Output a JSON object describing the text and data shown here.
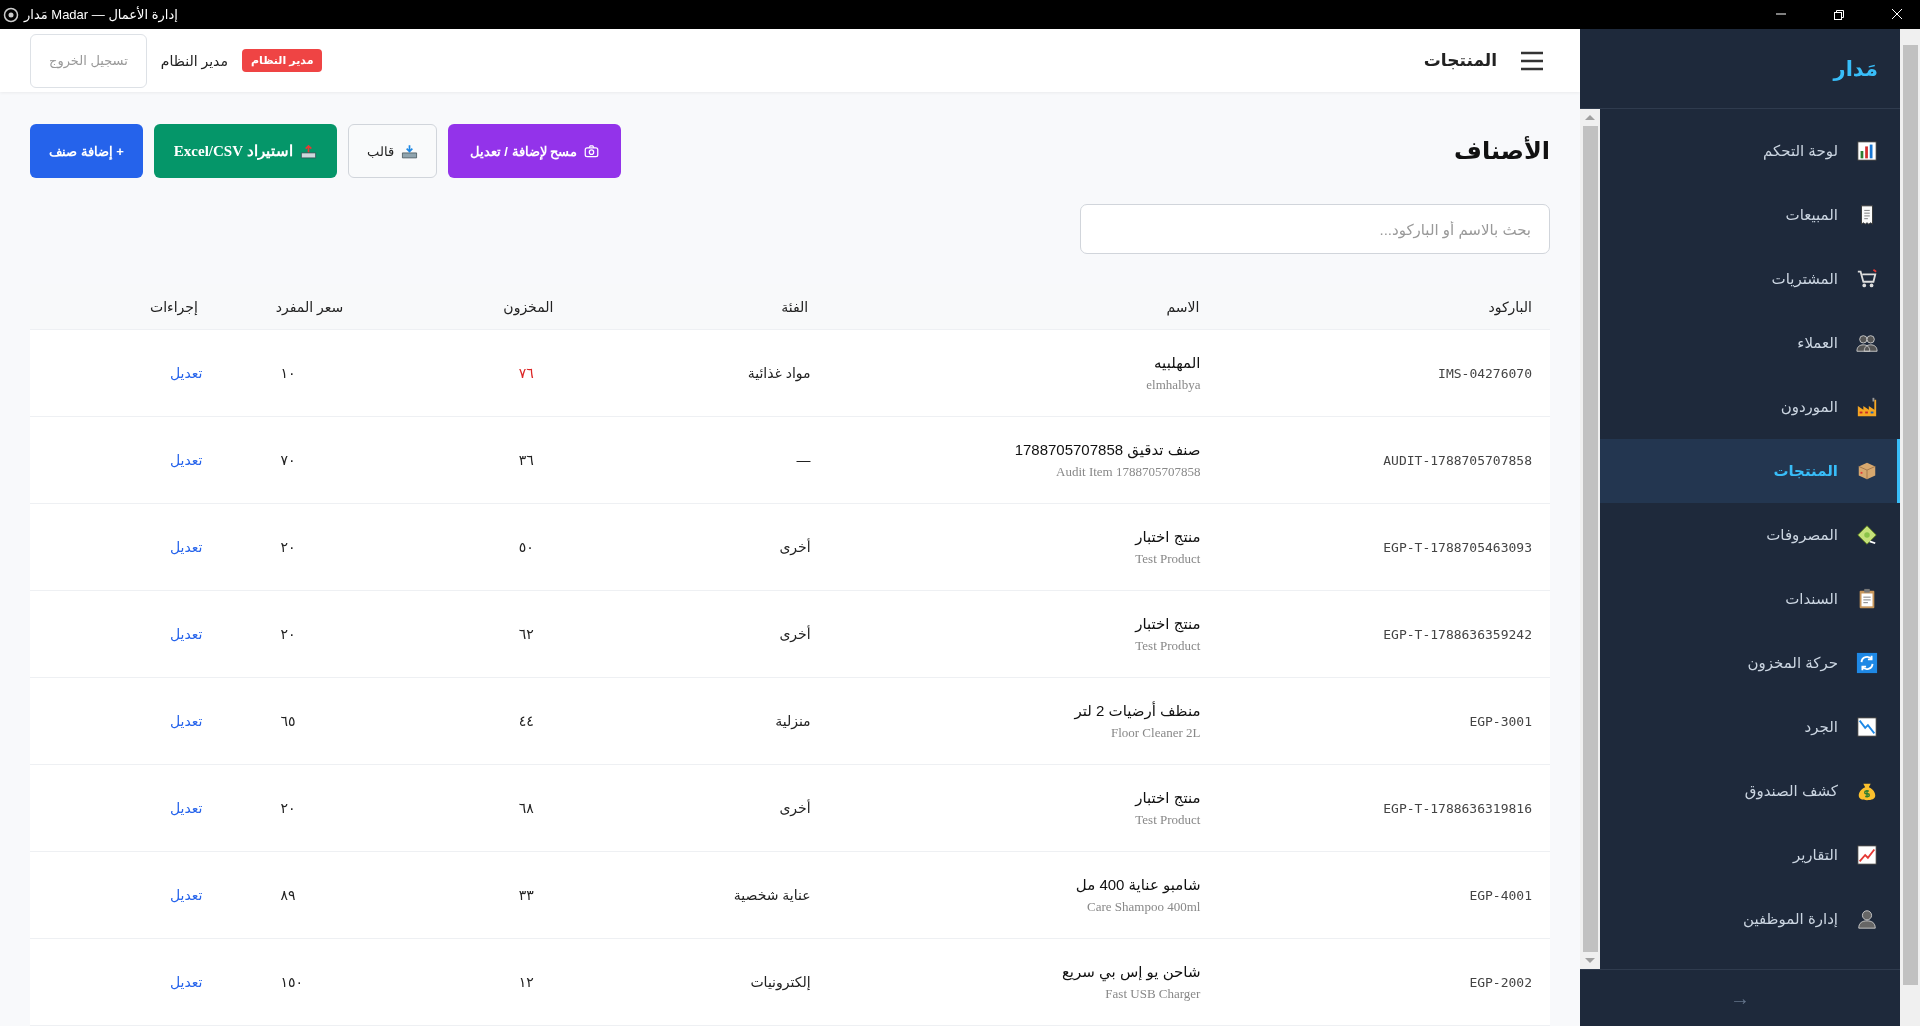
{
  "window": {
    "title": "مَدار Madar — إدارة الأعمال"
  },
  "header": {
    "title": "المنتجات",
    "role_badge": "مدير النظام",
    "user": "مدير النظام",
    "logout": "تسجيل الخروج"
  },
  "page": {
    "title": "الأصناف",
    "buttons": [
      {
        "kind": "scan",
        "label": "مسح لإضافة / تعديل"
      },
      {
        "kind": "template",
        "label": "قالب"
      },
      {
        "kind": "import",
        "label": "استيراد Excel/CSV"
      },
      {
        "kind": "add",
        "label": "+ إضافة صنف"
      }
    ],
    "search": {
      "placeholder": "بحث بالاسم أو الباركود..."
    }
  },
  "table": {
    "columns": [
      "الباركود",
      "الاسم",
      "الفئة",
      "المخزون",
      "سعر المفرد",
      "إجراءات"
    ],
    "rows": [
      {
        "barcode": "IMS-04276070",
        "name": "المهلبيه",
        "name_latin": "elmhalbya",
        "category": "مواد غذائية",
        "stock": "٧٦",
        "stock_low": true,
        "price": "١٠",
        "action": "تعديل"
      },
      {
        "barcode": "AUDIT-1788705707858",
        "name": "صنف تدقيق 1788705707858",
        "name_latin": "Audit Item 1788705707858",
        "category": "—",
        "stock": "٣٦",
        "stock_low": false,
        "price": "٧٠",
        "action": "تعديل"
      },
      {
        "barcode": "EGP-T-1788705463093",
        "name": "منتج اختبار",
        "name_latin": "Test Product",
        "category": "أخرى",
        "stock": "٥٠",
        "stock_low": false,
        "price": "٢٠",
        "action": "تعديل"
      },
      {
        "barcode": "EGP-T-1788636359242",
        "name": "منتج اختبار",
        "name_latin": "Test Product",
        "category": "أخرى",
        "stock": "٦٢",
        "stock_low": false,
        "price": "٢٠",
        "action": "تعديل"
      },
      {
        "barcode": "EGP-3001",
        "name": "منظف أرضيات 2 لتر",
        "name_latin": "Floor Cleaner 2L",
        "category": "منزلية",
        "stock": "٤٤",
        "stock_low": false,
        "price": "٦٥",
        "action": "تعديل"
      },
      {
        "barcode": "EGP-T-1788636319816",
        "name": "منتج اختبار",
        "name_latin": "Test Product",
        "category": "أخرى",
        "stock": "٦٨",
        "stock_low": false,
        "price": "٢٠",
        "action": "تعديل"
      },
      {
        "barcode": "EGP-4001",
        "name": "شامبو عناية 400 مل",
        "name_latin": "Care Shampoo 400ml",
        "category": "عناية شخصية",
        "stock": "٣٣",
        "stock_low": false,
        "price": "٨٩",
        "action": "تعديل"
      },
      {
        "barcode": "EGP-2002",
        "name": "شاحن يو إس بي سريع",
        "name_latin": "Fast USB Charger",
        "category": "إلكترونيات",
        "stock": "١٢",
        "stock_low": false,
        "price": "١٥٠",
        "action": "تعديل"
      }
    ]
  },
  "sidebar": {
    "logo": "مَدار",
    "items": [
      {
        "label": "لوحة التحكم",
        "selected": false
      },
      {
        "label": "المبيعات",
        "selected": false
      },
      {
        "label": "المشتريات",
        "selected": false
      },
      {
        "label": "العملاء",
        "selected": false
      },
      {
        "label": "الموردون",
        "selected": false
      },
      {
        "label": "المنتجات",
        "selected": true
      },
      {
        "label": "المصروفات",
        "selected": false
      },
      {
        "label": "السندات",
        "selected": false
      },
      {
        "label": "حركة المخزون",
        "selected": false
      },
      {
        "label": "الجرد",
        "selected": false
      },
      {
        "label": "كشف الصندوق",
        "selected": false
      },
      {
        "label": "التقارير",
        "selected": false
      },
      {
        "label": "إدارة الموظفين",
        "selected": false
      }
    ],
    "footer": "→"
  }
}
